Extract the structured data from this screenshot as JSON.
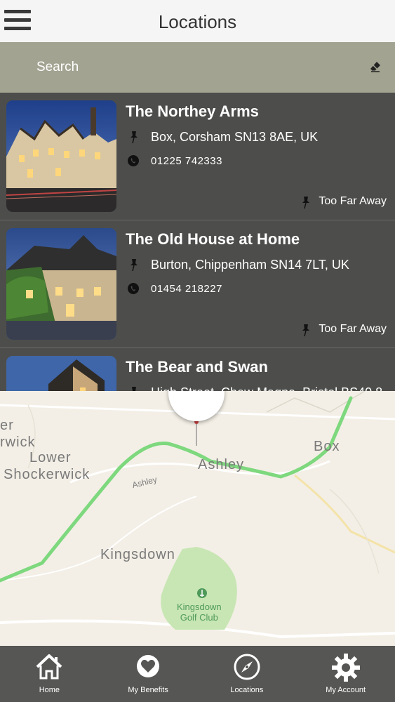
{
  "header": {
    "title": "Locations"
  },
  "search": {
    "placeholder": "Search"
  },
  "locations": [
    {
      "name": "The Northey Arms",
      "address": "Box, Corsham SN13 8AE, UK",
      "phone": "01225 742333",
      "status": "Too Far Away"
    },
    {
      "name": "The Old House at Home",
      "address": "Burton, Chippenham SN14 7LT, UK",
      "phone": "01454 218227",
      "status": "Too Far Away"
    },
    {
      "name": "The Bear and Swan",
      "address": "High Street, Chew Magna, Bristol BS40 8",
      "phone": "",
      "status": ""
    }
  ],
  "map": {
    "labels": {
      "er": "er",
      "rwick": "rwick",
      "lower": "Lower",
      "shockerwick": "Shockerwick",
      "ashley": "Ashley",
      "ashley_road": "Ashley",
      "box": "Box",
      "kingsdown": "Kingsdown",
      "golf_line1": "Kingsdown",
      "golf_line2": "Golf Club"
    },
    "colors": {
      "route": "#7ed87e",
      "golf_area": "#c8e6b4",
      "background": "#f3efe6"
    }
  },
  "tabs": [
    {
      "label": "Home",
      "icon": "home-icon"
    },
    {
      "label": "My Benefits",
      "icon": "heart-icon"
    },
    {
      "label": "Locations",
      "icon": "compass-icon"
    },
    {
      "label": "My Account",
      "icon": "gear-icon"
    }
  ],
  "colors": {
    "header": "#f5f5f5",
    "search": "#a3a392",
    "list": "#4d4e4b",
    "tabbar": "#565654"
  }
}
